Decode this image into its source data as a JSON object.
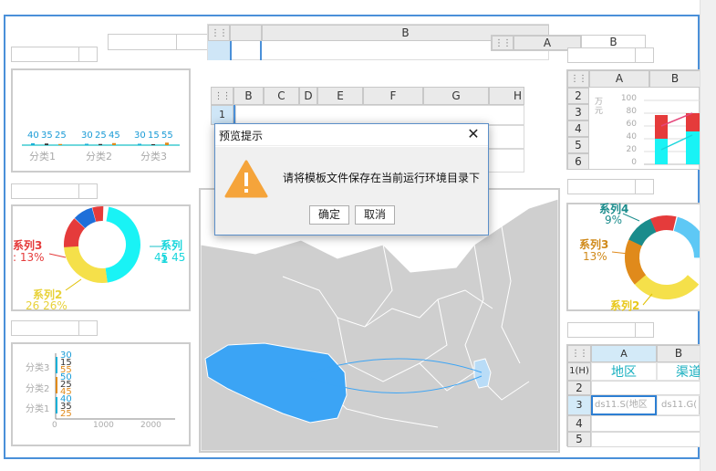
{
  "top_widgets": {
    "col_b_label": "B",
    "col_a_label": "A",
    "col_b2_label": "B"
  },
  "mini_bar": {
    "labels": [
      "40",
      "35",
      "25",
      "30",
      "25",
      "45",
      "30",
      "15",
      "55"
    ],
    "categories": [
      "分类1",
      "分类2",
      "分类3"
    ]
  },
  "center_grid": {
    "columns": [
      "B",
      "C",
      "D",
      "E",
      "F",
      "G",
      "H"
    ],
    "rows": [
      "1"
    ]
  },
  "right_grid_top": {
    "columns": [
      "A",
      "B"
    ],
    "rows": [
      "2",
      "3",
      "4",
      "5",
      "6"
    ],
    "unit_label": "万元",
    "yticks": [
      "100",
      "80",
      "60",
      "40",
      "20",
      "0"
    ]
  },
  "donut_left": {
    "series3_label": "系列3",
    "series3_value": ": 13%",
    "series1_label": "系列1",
    "series1_value": "45  45",
    "series2_label": "系列2",
    "series2_value": "26  26%"
  },
  "donut_right": {
    "series4_label": "系列4",
    "series4_value": "9%",
    "series3_label": "系列3",
    "series3_value": "13%",
    "series2_label": "系列2"
  },
  "hbar": {
    "categories": [
      "分类3",
      "分类2",
      "分类1"
    ],
    "values": [
      "30",
      "15",
      "55",
      "50",
      "25",
      "45",
      "40",
      "35",
      "25"
    ],
    "xticks": [
      "0",
      "1000",
      "2000"
    ]
  },
  "right_grid_bottom": {
    "columns": [
      "A",
      "B"
    ],
    "row_labels": [
      "1(H)",
      "2",
      "3",
      "4",
      "5"
    ],
    "header_a": "地区",
    "header_b": "渠道",
    "cell_a3": "ds11.S(地区",
    "cell_b3": "ds11.G("
  },
  "dialog": {
    "title": "预览提示",
    "message": "请将模板文件保存在当前运行环境目录下",
    "ok_label": "确定",
    "cancel_label": "取消"
  },
  "colors": {
    "cyan": "#19f3f5",
    "red": "#e53b3b",
    "yellow": "#f5e04a",
    "orange": "#e08a1b",
    "blue": "#1e6fd9",
    "teal": "#1a8c8c",
    "warning": "#f5a43b",
    "map_gray": "#cfcfcf",
    "map_highlight": "#3ba4f5"
  }
}
